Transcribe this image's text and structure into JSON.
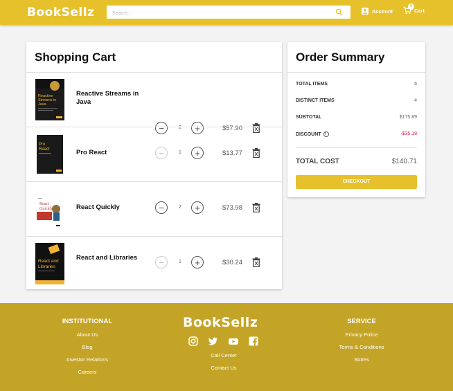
{
  "header": {
    "logo": "BookSell̅z",
    "logo_text": "BookSellz",
    "search_placeholder": "Search...",
    "account_label": "Account",
    "cart_label": "Cart",
    "cart_count": "0"
  },
  "cart": {
    "title": "Shopping Cart",
    "items": [
      {
        "title": "Reactive Streams in Java",
        "qty": "2",
        "price": "$57.90",
        "cover": "Reactive Streams in Java"
      },
      {
        "title": "Pro React",
        "qty": "1",
        "price": "$13.77",
        "cover": "Pro React"
      },
      {
        "title": "React Quickly",
        "qty": "2",
        "price": "$73.98",
        "cover": "React Quickly"
      },
      {
        "title": "React and Libraries",
        "qty": "1",
        "price": "$30.24",
        "cover": "React and Libraries"
      }
    ]
  },
  "summary": {
    "title": "Order Summary",
    "total_items_label": "TOTAL ITEMS",
    "total_items": "6",
    "distinct_items_label": "DISTINCT ITEMS",
    "distinct_items": "4",
    "subtotal_label": "SUBTOTAL",
    "subtotal": "$175.89",
    "discount_label": "DISCOUNT",
    "discount": "-$35.18",
    "total_label": "TOTAL COST",
    "total": "$140.71",
    "checkout_label": "CHECKOUT"
  },
  "footer": {
    "logo": "BookSellz",
    "institutional": {
      "heading": "INSTITUTIONAL",
      "links": [
        "About Us",
        "Blog",
        "Investor Relations",
        "Careers"
      ]
    },
    "middle_links": [
      "Call Center",
      "Contact Us"
    ],
    "service": {
      "heading": "SERVICE",
      "links": [
        "Privacy Police",
        "Terms & Conditions",
        "Stores"
      ]
    },
    "social_icons": [
      "instagram-icon",
      "twitter-icon",
      "youtube-icon",
      "facebook-icon"
    ]
  },
  "colors": {
    "brand": "#e6c12c",
    "footer": "#c4a426",
    "discount": "#d11a4a"
  }
}
